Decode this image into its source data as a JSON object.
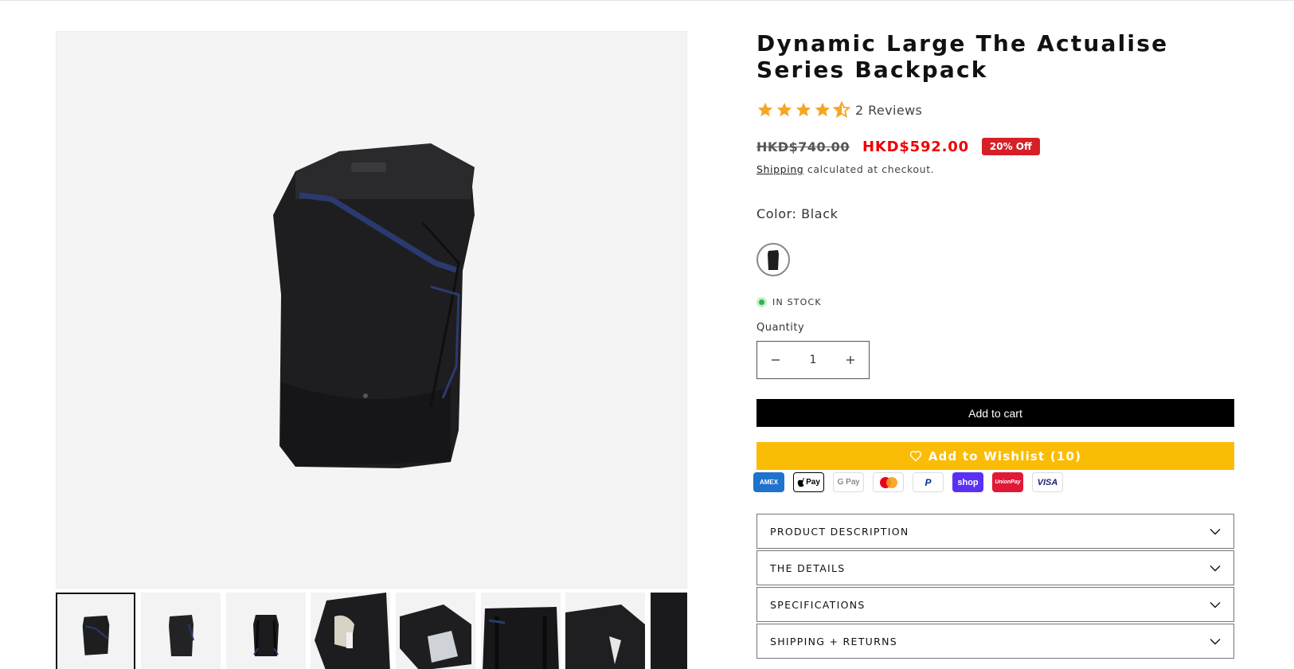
{
  "product": {
    "title": "Dynamic Large The Actualise Series Backpack",
    "rating": 4.5,
    "reviews_label": "2 Reviews",
    "price_old": "HKD$740.00",
    "price_new": "HKD$592.00",
    "discount_badge": "20% Off",
    "shipping_link": "Shipping",
    "shipping_text": " calculated at checkout.",
    "color_label": "Color: Black",
    "stock_label": "IN STOCK",
    "quantity_label": "Quantity",
    "quantity_value": "1",
    "add_to_cart": "Add to cart",
    "wishlist": "Add to Wishlist (10)"
  },
  "payments": [
    {
      "name": "amex-icon",
      "label": "AMEX",
      "bg": "#1f72cd",
      "fg": "#ffffff"
    },
    {
      "name": "apple-pay-icon",
      "label": " Pay",
      "bg": "#ffffff",
      "fg": "#000000"
    },
    {
      "name": "google-pay-icon",
      "label": "G Pay",
      "bg": "#ffffff",
      "fg": "#5f6368"
    },
    {
      "name": "mastercard-icon",
      "label": "",
      "bg": "#ffffff",
      "fg": "#000000"
    },
    {
      "name": "paypal-icon",
      "label": "P",
      "bg": "#ffffff",
      "fg": "#003087"
    },
    {
      "name": "shop-pay-icon",
      "label": "shop",
      "bg": "#5a31f4",
      "fg": "#ffffff"
    },
    {
      "name": "unionpay-icon",
      "label": "UnionPay",
      "bg": "#e21836",
      "fg": "#ffffff"
    },
    {
      "name": "visa-icon",
      "label": "VISA",
      "bg": "#ffffff",
      "fg": "#1a1f71"
    }
  ],
  "accordion": [
    "PRODUCT DESCRIPTION",
    "THE DETAILS",
    "SPECIFICATIONS",
    "SHIPPING + RETURNS"
  ],
  "colors": {
    "accent": "#fbbc05",
    "sale": "#e00000",
    "badge": "#d62028",
    "star": "#f5a623",
    "in_stock": "#2fb54a"
  }
}
